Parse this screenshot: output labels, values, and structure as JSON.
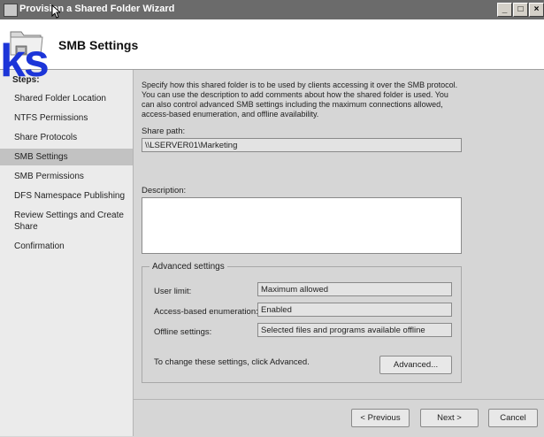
{
  "window": {
    "title": "Provision a Shared Folder Wizard",
    "controls": [
      "_",
      "□",
      "×"
    ]
  },
  "header": {
    "title": "SMB Settings"
  },
  "overlay": {
    "text": "ks"
  },
  "sidebar": {
    "heading": "Steps:",
    "items": [
      {
        "label": "Shared Folder Location"
      },
      {
        "label": "NTFS Permissions"
      },
      {
        "label": "Share Protocols"
      },
      {
        "label": "SMB Settings",
        "active": true
      },
      {
        "label": "SMB Permissions"
      },
      {
        "label": "DFS Namespace Publishing"
      },
      {
        "label": "Review Settings and Create Share"
      },
      {
        "label": "Confirmation"
      }
    ]
  },
  "main": {
    "intro": "Specify how this shared folder is to be used by clients accessing it over the SMB protocol. You can use the description to add comments about how the shared folder is used. You can also control advanced SMB settings including the maximum connections allowed, access-based enumeration, and offline availability.",
    "share_path_label": "Share path:",
    "share_path_value": "\\\\LSERVER01\\Marketing",
    "description_label": "Description:",
    "description_value": "",
    "advanced": {
      "legend": "Advanced settings",
      "user_limit_label": "User limit:",
      "user_limit_value": "Maximum allowed",
      "abe_label": "Access-based enumeration:",
      "abe_value": "Enabled",
      "offline_label": "Offline settings:",
      "offline_value": "Selected files and programs available offline",
      "change_hint": "To change these settings, click Advanced.",
      "advanced_button": "Advanced..."
    }
  },
  "footer": {
    "previous": "< Previous",
    "next": "Next >",
    "cancel": "Cancel"
  },
  "colors": {
    "titlebar": "#6b6b6b",
    "watermark": "#1c35d8",
    "sidebar_active": "#c2c2c2"
  },
  "icons": [
    "wizard-app-icon",
    "shared-folder-icon",
    "mouse-cursor-icon"
  ]
}
